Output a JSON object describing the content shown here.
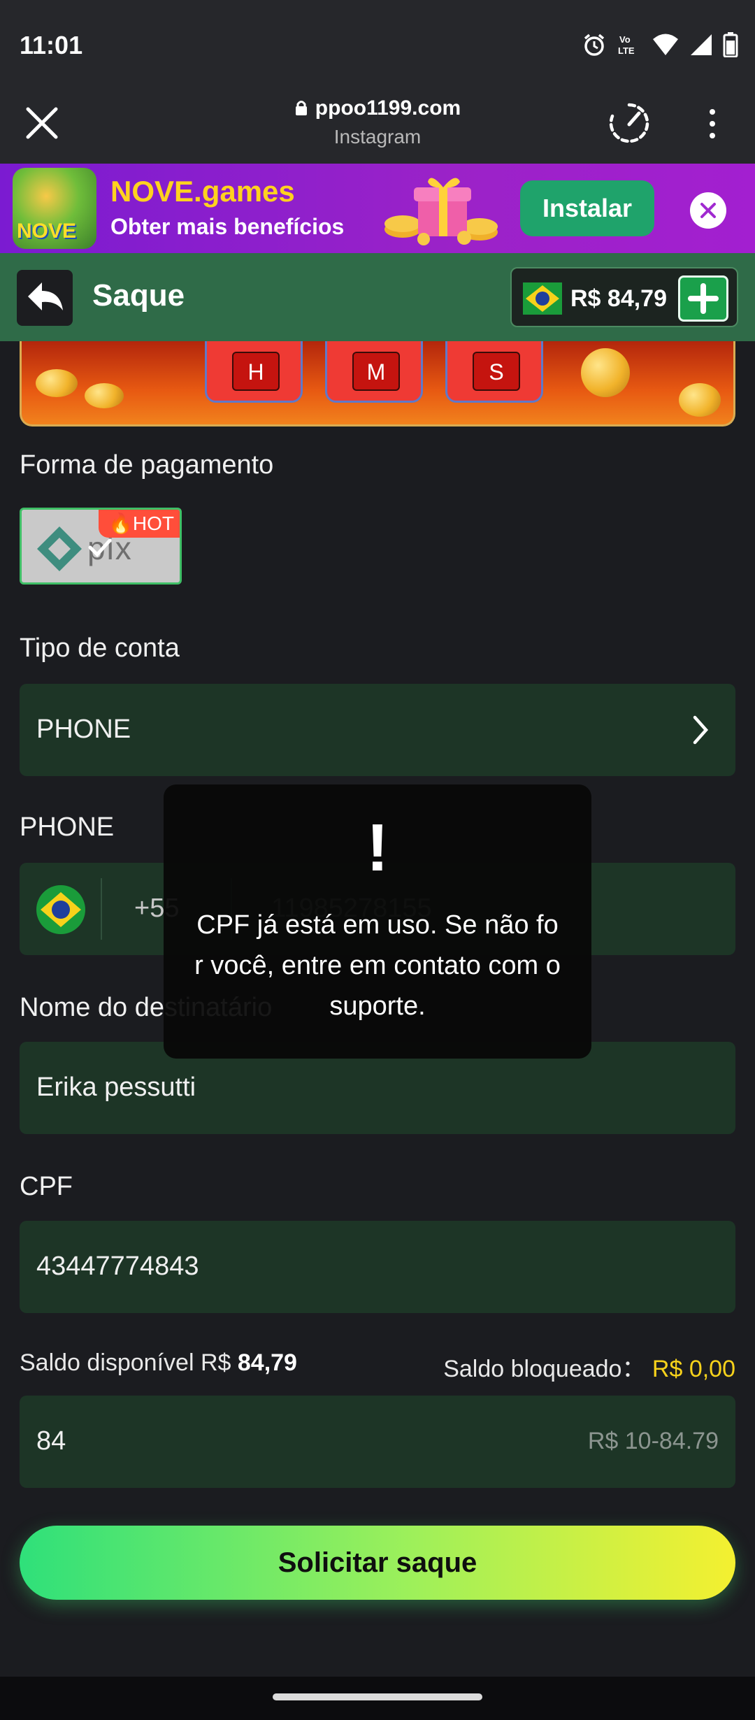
{
  "status": {
    "time": "11:01",
    "icons": [
      "alarm-icon",
      "volte-icon",
      "wifi-icon",
      "signal-icon",
      "battery-icon"
    ]
  },
  "browser": {
    "url": "ppoo1199.com",
    "subtitle": "Instagram"
  },
  "promo": {
    "title": "NOVE.games",
    "subtitle": "Obter mais benefícios",
    "install_label": "Instalar",
    "logo_text": "NOVE"
  },
  "header": {
    "title": "Saque",
    "balance": "R$ 84,79"
  },
  "countdown": {
    "labels": [
      "H",
      "M",
      "S"
    ]
  },
  "form": {
    "payment_label": "Forma de pagamento",
    "payment_method": "pix",
    "hot_badge": "HOT",
    "account_type_label": "Tipo de conta",
    "account_type_value": "PHONE",
    "phone_label": "PHONE",
    "country_code": "+55",
    "phone_placeholder": "11985278155",
    "recipient_label": "Nome do destinatário",
    "recipient_value": "Erika pessutti",
    "cpf_label": "CPF",
    "cpf_value": "43447774843",
    "available_label": "Saldo disponível R$",
    "available_value": "84,79",
    "blocked_label": "Saldo bloqueado：",
    "blocked_value": "R$ 0,00",
    "amount_value": "84",
    "amount_range": "R$ 10-84.79",
    "submit_label": "Solicitar saque"
  },
  "toast": {
    "icon": "!",
    "message": "CPF já está em uso. Se não for você, entre em contato com o suporte."
  },
  "colors": {
    "accent_green": "#2f6b48",
    "field_bg": "#1d3526",
    "highlight_yellow": "#f7d21b",
    "promo_purple": "#9b22c8"
  }
}
